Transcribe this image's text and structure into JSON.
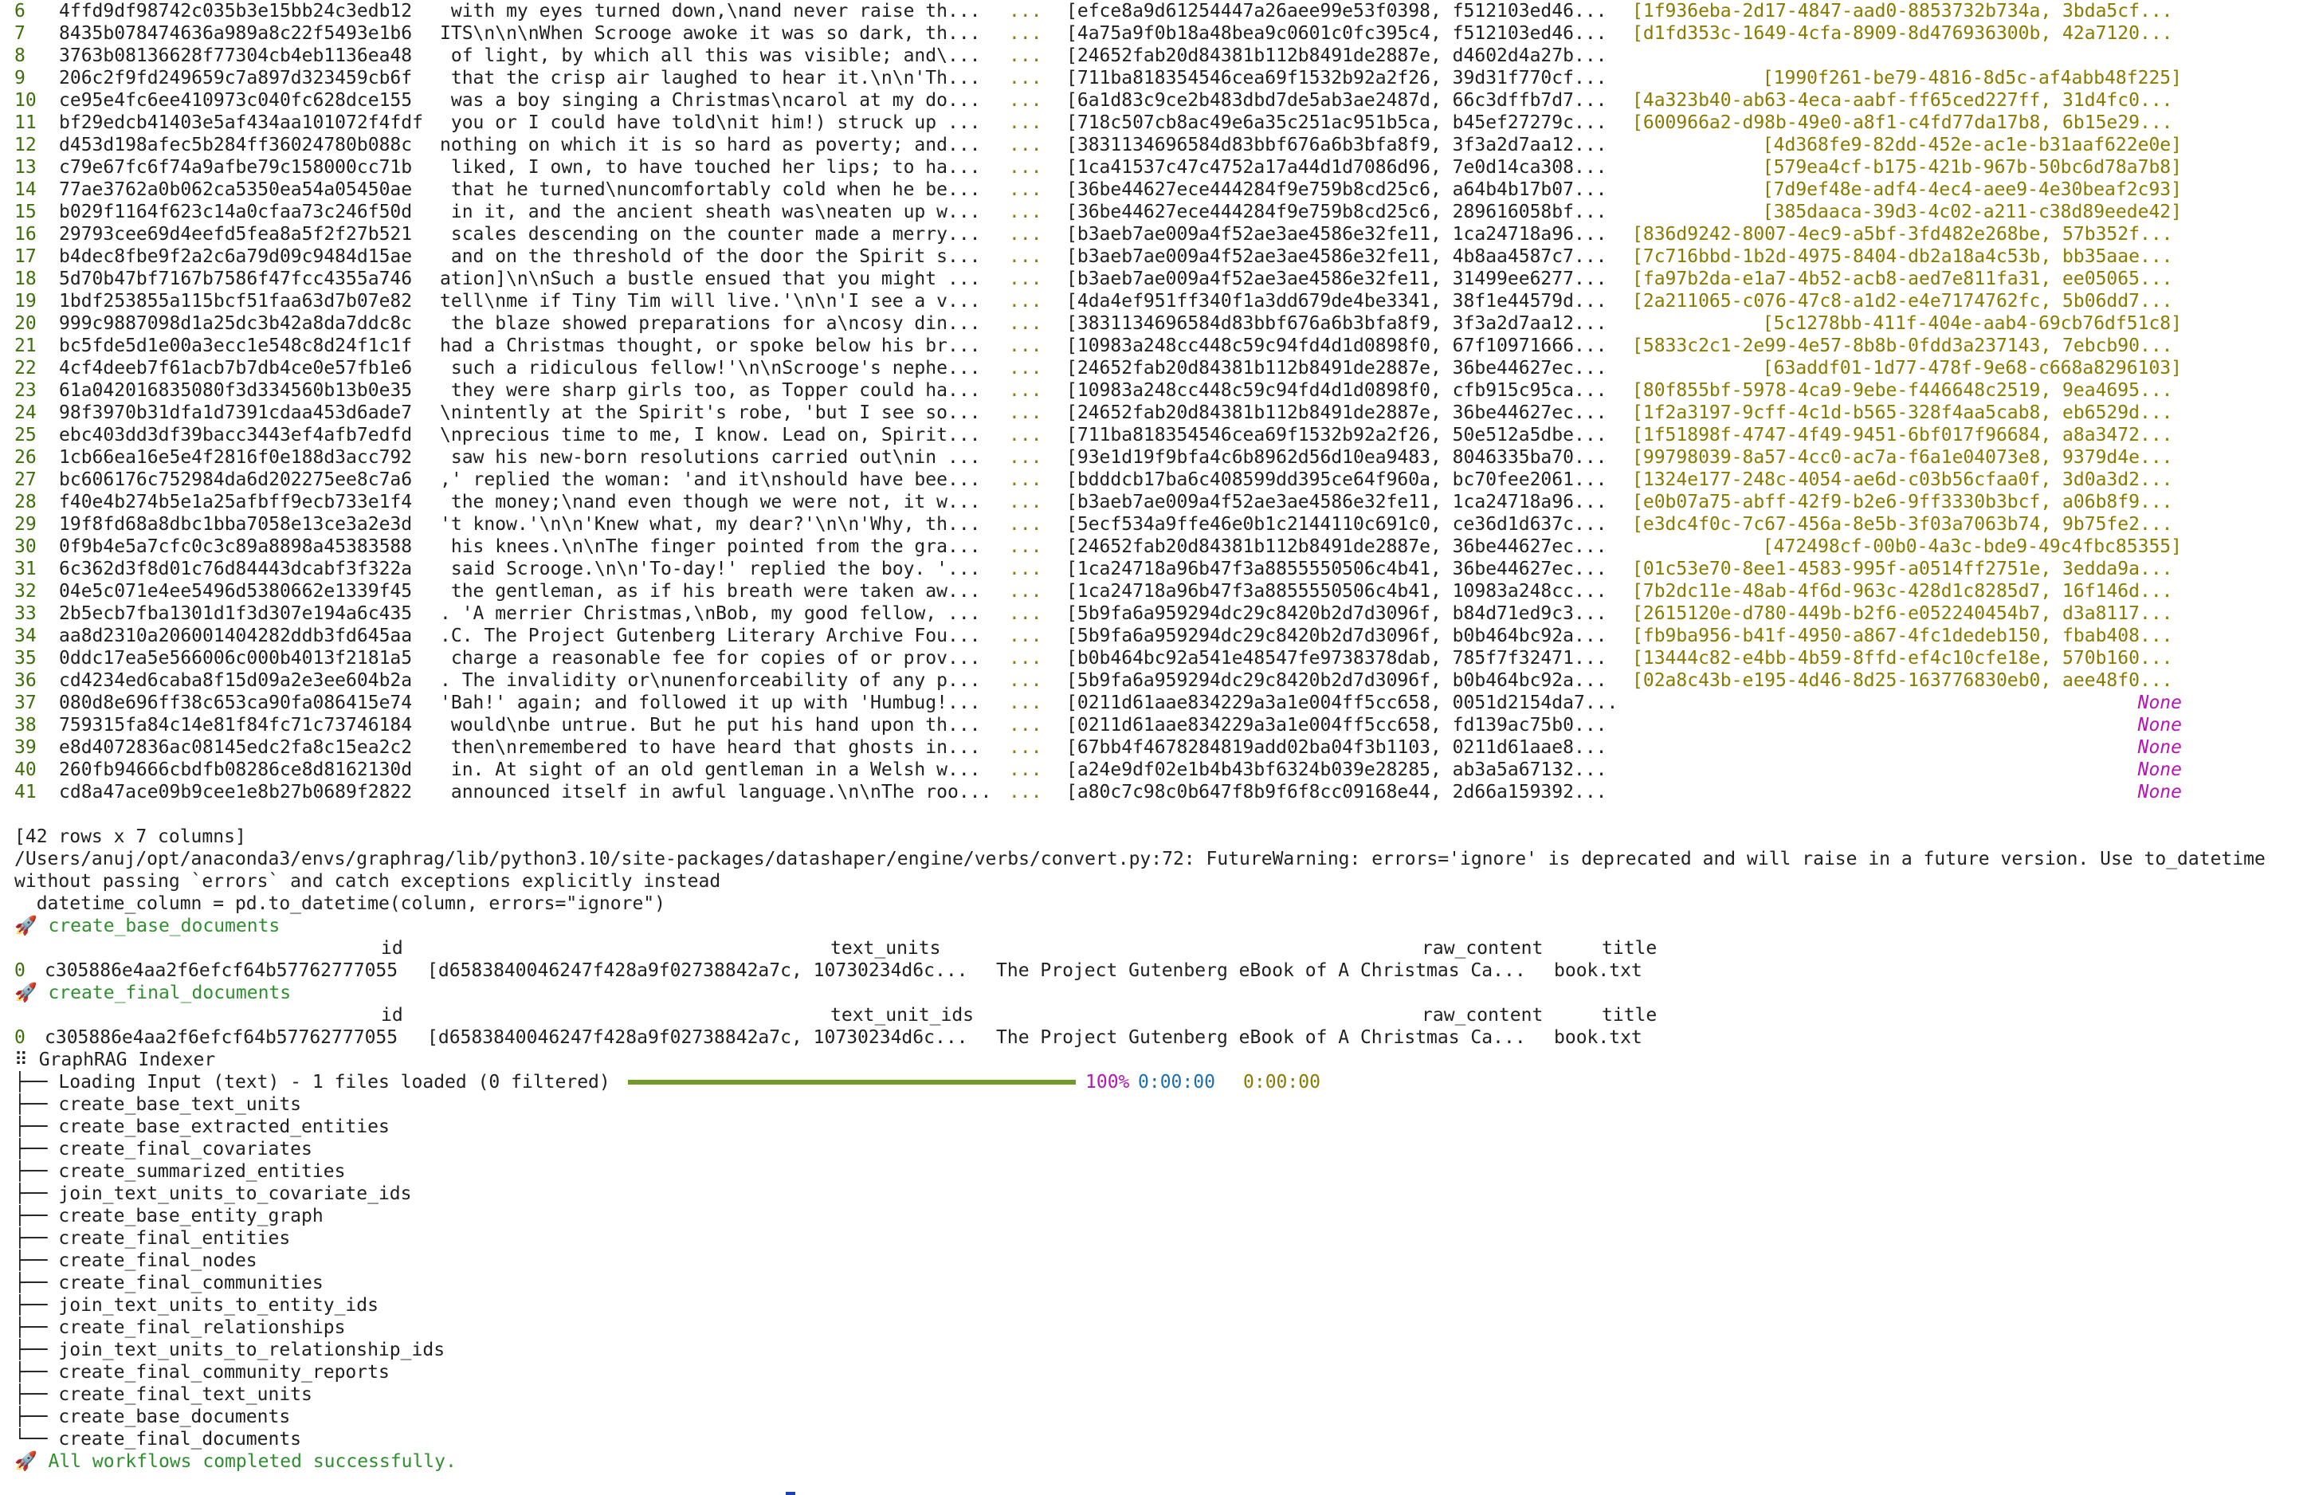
{
  "colors": {
    "index": "#3d6f0a",
    "olive": "#8a7a00",
    "string": "#2f8f2f",
    "none": "#b516b5",
    "progress": "#6f9a2a",
    "time": "#1a6fb0"
  },
  "table_rows": [
    {
      "idx": "6",
      "id": "4ffd9df98742c035b3e15bb24c3edb12",
      "text": " with my eyes turned down,\\nand never raise th...",
      "ell": "...",
      "doc": "[efce8a9d61254447a26aee99e53f0398, f512103ed46...",
      "rel": "[1f936eba-2d17-4847-aad0-8853732b734a, 3bda5cf...",
      "rel_right": false
    },
    {
      "idx": "7",
      "id": "8435b078474636a989a8c22f5493e1b6",
      "text": "ITS\\n\\n\\nWhen Scrooge awoke it was so dark, th...",
      "ell": "...",
      "doc": "[4a75a9f0b18a48bea9c0601c0fc395c4, f512103ed46...",
      "rel": "[d1fd353c-1649-4cfa-8909-8d476936300b, 42a7120...",
      "rel_right": false
    },
    {
      "idx": "8",
      "id": "3763b08136628f77304cb4eb1136ea48",
      "text": " of light, by which all this was visible; and\\...",
      "ell": "...",
      "doc": "[24652fab20d84381b112b8491de2887e, d4602d4a27b...",
      "rel": "",
      "rel_right": false
    },
    {
      "idx": "9",
      "id": "206c2f9fd249659c7a897d323459cb6f",
      "text": " that the crisp air laughed to hear it.\\n\\n'Th...",
      "ell": "...",
      "doc": "[711ba818354546cea69f1532b92a2f26, 39d31f770cf...",
      "rel": "[1990f261-be79-4816-8d5c-af4abb48f225]",
      "rel_right": true
    },
    {
      "idx": "10",
      "id": "ce95e4fc6ee410973c040fc628dce155",
      "text": " was a boy singing a Christmas\\ncarol at my do...",
      "ell": "...",
      "doc": "[6a1d83c9ce2b483dbd7de5ab3ae2487d, 66c3dffb7d7...",
      "rel": "[4a323b40-ab63-4eca-aabf-ff65ced227ff, 31d4fc0...",
      "rel_right": false
    },
    {
      "idx": "11",
      "id": "bf29edcb41403e5af434aa101072f4fdf",
      "text": " you or I could have told\\nit him!) struck up ...",
      "ell": "...",
      "doc": "[718c507cb8ac49e6a35c251ac951b5ca, b45ef27279c...",
      "rel": "[600966a2-d98b-49e0-a8f1-c4fd77da17b8, 6b15e29...",
      "rel_right": false
    },
    {
      "idx": "12",
      "id": "d453d198afec5b284ff36024780b088c",
      "text": "nothing on which it is so hard as poverty; and...",
      "ell": "...",
      "doc": "[3831134696584d83bbf676a6b3bfa8f9, 3f3a2d7aa12...",
      "rel": "[4d368fe9-82dd-452e-ac1e-b31aaf622e0e]",
      "rel_right": true
    },
    {
      "idx": "13",
      "id": "c79e67fc6f74a9afbe79c158000cc71b",
      "text": " liked, I own, to have touched her lips; to ha...",
      "ell": "...",
      "doc": "[1ca41537c47c4752a17a44d1d7086d96, 7e0d14ca308...",
      "rel": "[579ea4cf-b175-421b-967b-50bc6d78a7b8]",
      "rel_right": true
    },
    {
      "idx": "14",
      "id": "77ae3762a0b062ca5350ea54a05450ae",
      "text": " that he turned\\nuncomfortably cold when he be...",
      "ell": "...",
      "doc": "[36be44627ece444284f9e759b8cd25c6, a64b4b17b07...",
      "rel": "[7d9ef48e-adf4-4ec4-aee9-4e30beaf2c93]",
      "rel_right": true
    },
    {
      "idx": "15",
      "id": "b029f1164f623c14a0cfaa73c246f50d",
      "text": " in it, and the ancient sheath was\\neaten up w...",
      "ell": "...",
      "doc": "[36be44627ece444284f9e759b8cd25c6, 289616058bf...",
      "rel": "[385daaca-39d3-4c02-a211-c38d89eede42]",
      "rel_right": true
    },
    {
      "idx": "16",
      "id": "29793cee69d4eefd5fea8a5f2f27b521",
      "text": " scales descending on the counter made a merry...",
      "ell": "...",
      "doc": "[b3aeb7ae009a4f52ae3ae4586e32fe11, 1ca24718a96...",
      "rel": "[836d9242-8007-4ec9-a5bf-3fd482e268be, 57b352f...",
      "rel_right": false
    },
    {
      "idx": "17",
      "id": "b4dec8fbe9f2a2c6a79d09c9484d15ae",
      "text": " and on the threshold of the door the Spirit s...",
      "ell": "...",
      "doc": "[b3aeb7ae009a4f52ae3ae4586e32fe11, 4b8aa4587c7...",
      "rel": "[7c716bbd-1b2d-4975-8404-db2a18a4c53b, bb35aae...",
      "rel_right": false
    },
    {
      "idx": "18",
      "id": "5d70b47bf7167b7586f47fcc4355a746",
      "text": "ation]\\n\\nSuch a bustle ensued that you might ...",
      "ell": "...",
      "doc": "[b3aeb7ae009a4f52ae3ae4586e32fe11, 31499ee6277...",
      "rel": "[fa97b2da-e1a7-4b52-acb8-aed7e811fa31, ee05065...",
      "rel_right": false
    },
    {
      "idx": "19",
      "id": "1bdf253855a115bcf51faa63d7b07e82",
      "text": "tell\\nme if Tiny Tim will live.'\\n\\n'I see a v...",
      "ell": "...",
      "doc": "[4da4ef951ff340f1a3dd679de4be3341, 38f1e44579d...",
      "rel": "[2a211065-c076-47c8-a1d2-e4e7174762fc, 5b06dd7...",
      "rel_right": false
    },
    {
      "idx": "20",
      "id": "999c9887098d1a25dc3b42a8da7ddc8c",
      "text": " the blaze showed preparations for a\\ncosy din...",
      "ell": "...",
      "doc": "[3831134696584d83bbf676a6b3bfa8f9, 3f3a2d7aa12...",
      "rel": "[5c1278bb-411f-404e-aab4-69cb76df51c8]",
      "rel_right": true
    },
    {
      "idx": "21",
      "id": "bc5fde5d1e00a3ecc1e548c8d24f1c1f",
      "text": "had a Christmas thought, or spoke below his br...",
      "ell": "...",
      "doc": "[10983a248cc448c59c94fd4d1d0898f0, 67f10971666...",
      "rel": "[5833c2c1-2e99-4e57-8b8b-0fdd3a237143, 7ebcb90...",
      "rel_right": false
    },
    {
      "idx": "22",
      "id": "4cf4deeb7f61acb7b7db4ce0e57fb1e6",
      "text": " such a ridiculous fellow!'\\n\\nScrooge's nephe...",
      "ell": "...",
      "doc": "[24652fab20d84381b112b8491de2887e, 36be44627ec...",
      "rel": "[63addf01-1d77-478f-9e68-c668a8296103]",
      "rel_right": true
    },
    {
      "idx": "23",
      "id": "61a042016835080f3d334560b13b0e35",
      "text": " they were sharp girls too, as Topper could ha...",
      "ell": "...",
      "doc": "[10983a248cc448c59c94fd4d1d0898f0, cfb915c95ca...",
      "rel": "[80f855bf-5978-4ca9-9ebe-f446648c2519, 9ea4695...",
      "rel_right": false
    },
    {
      "idx": "24",
      "id": "98f3970b31dfa1d7391cdaa453d6ade7",
      "text": "\\nintently at the Spirit's robe, 'but I see so...",
      "ell": "...",
      "doc": "[24652fab20d84381b112b8491de2887e, 36be44627ec...",
      "rel": "[1f2a3197-9cff-4c1d-b565-328f4aa5cab8, eb6529d...",
      "rel_right": false
    },
    {
      "idx": "25",
      "id": "ebc403dd3df39bacc3443ef4afb7edfd",
      "text": "\\nprecious time to me, I know. Lead on, Spirit...",
      "ell": "...",
      "doc": "[711ba818354546cea69f1532b92a2f26, 50e512a5dbe...",
      "rel": "[1f51898f-4747-4f49-9451-6bf017f96684, a8a3472...",
      "rel_right": false
    },
    {
      "idx": "26",
      "id": "1cb66ea16e5e4f2816f0e188d3acc792",
      "text": " saw his new-born resolutions carried out\\nin ...",
      "ell": "...",
      "doc": "[93e1d19f9bfa4c6b8962d56d10ea9483, 8046335ba70...",
      "rel": "[99798039-8a57-4cc0-ac7a-f6a1e04073e8, 9379d4e...",
      "rel_right": false
    },
    {
      "idx": "27",
      "id": "bc606176c752984da6d202275ee8c7a6",
      "text": ",' replied the woman: 'and it\\nshould have bee...",
      "ell": "...",
      "doc": "[bdddcb17ba6c408599dd395ce64f960a, bc70fee2061...",
      "rel": "[1324e177-248c-4054-ae6d-c03b56cfaa0f, 3d0a3d2...",
      "rel_right": false
    },
    {
      "idx": "28",
      "id": "f40e4b274b5e1a25afbff9ecb733e1f4",
      "text": " the money;\\nand even though we were not, it w...",
      "ell": "...",
      "doc": "[b3aeb7ae009a4f52ae3ae4586e32fe11, 1ca24718a96...",
      "rel": "[e0b07a75-abff-42f9-b2e6-9ff3330b3bcf, a06b8f9...",
      "rel_right": false
    },
    {
      "idx": "29",
      "id": "19f8fd68a8dbc1bba7058e13ce3a2e3d",
      "text": "'t know.'\\n\\n'Knew what, my dear?'\\n\\n'Why, th...",
      "ell": "...",
      "doc": "[5ecf534a9ffe46e0b1c2144110c691c0, ce36d1d637c...",
      "rel": "[e3dc4f0c-7c67-456a-8e5b-3f03a7063b74, 9b75fe2...",
      "rel_right": false
    },
    {
      "idx": "30",
      "id": "0f9b4e5a7cfc0c3c89a8898a45383588",
      "text": " his knees.\\n\\nThe finger pointed from the gra...",
      "ell": "...",
      "doc": "[24652fab20d84381b112b8491de2887e, 36be44627ec...",
      "rel": "[472498cf-00b0-4a3c-bde9-49c4fbc85355]",
      "rel_right": true
    },
    {
      "idx": "31",
      "id": "6c362d3f8d01c76d84443dcabf3f322a",
      "text": " said Scrooge.\\n\\n'To-day!' replied the boy. '...",
      "ell": "...",
      "doc": "[1ca24718a96b47f3a8855550506c4b41, 36be44627ec...",
      "rel": "[01c53e70-8ee1-4583-995f-a0514ff2751e, 3edda9a...",
      "rel_right": false
    },
    {
      "idx": "32",
      "id": "04e5c071e4ee5496d5380662e1339f45",
      "text": " the gentleman, as if his breath were taken aw...",
      "ell": "...",
      "doc": "[1ca24718a96b47f3a8855550506c4b41, 10983a248cc...",
      "rel": "[7b2dc11e-48ab-4f6d-963c-428d1c8285d7, 16f146d...",
      "rel_right": false
    },
    {
      "idx": "33",
      "id": "2b5ecb7fba1301d1f3d307e194a6c435",
      "text": ". 'A merrier Christmas,\\nBob, my good fellow, ...",
      "ell": "...",
      "doc": "[5b9fa6a959294dc29c8420b2d7d3096f, b84d71ed9c3...",
      "rel": "[2615120e-d780-449b-b2f6-e052240454b7, d3a8117...",
      "rel_right": false
    },
    {
      "idx": "34",
      "id": "aa8d2310a206001404282ddb3fd645aa",
      "text": ".C. The Project Gutenberg Literary Archive Fou...",
      "ell": "...",
      "doc": "[5b9fa6a959294dc29c8420b2d7d3096f, b0b464bc92a...",
      "rel": "[fb9ba956-b41f-4950-a867-4fc1dedeb150, fbab408...",
      "rel_right": false
    },
    {
      "idx": "35",
      "id": "0ddc17ea5e566006c000b4013f2181a5",
      "text": " charge a reasonable fee for copies of or prov...",
      "ell": "...",
      "doc": "[b0b464bc92a541e48547fe9738378dab, 785f7f32471...",
      "rel": "[13444c82-e4bb-4b59-8ffd-ef4c10cfe18e, 570b160...",
      "rel_right": false
    },
    {
      "idx": "36",
      "id": "cd4234ed6caba8f15d09a2e3ee604b2a",
      "text": ". The invalidity or\\nunenforceability of any p...",
      "ell": "...",
      "doc": "[5b9fa6a959294dc29c8420b2d7d3096f, b0b464bc92a...",
      "rel": "[02a8c43b-e195-4d46-8d25-163776830eb0, aee48f0...",
      "rel_right": false
    },
    {
      "idx": "37",
      "id": "080d8e696ff38c653ca90fa086415e74",
      "text": "'Bah!' again; and followed it up with 'Humbug!...",
      "ell": "...",
      "doc": "[0211d61aae834229a3a1e004ff5cc658, 0051d2154da7...",
      "rel": "None",
      "rel_right": true
    },
    {
      "idx": "38",
      "id": "759315fa84c14e81f84fc71c73746184",
      "text": " would\\nbe untrue. But he put his hand upon th...",
      "ell": "...",
      "doc": "[0211d61aae834229a3a1e004ff5cc658, fd139ac75b0...",
      "rel": "None",
      "rel_right": true
    },
    {
      "idx": "39",
      "id": "e8d4072836ac08145edc2fa8c15ea2c2",
      "text": " then\\nremembered to have heard that ghosts in...",
      "ell": "...",
      "doc": "[67bb4f4678284819add02ba04f3b1103, 0211d61aae8...",
      "rel": "None",
      "rel_right": true
    },
    {
      "idx": "40",
      "id": "260fb94666cbdfb08286ce8d8162130d",
      "text": " in. At sight of an old gentleman in a Welsh w...",
      "ell": "...",
      "doc": "[a24e9df02e1b4b43bf6324b039e28285, ab3a5a67132...",
      "rel": "None",
      "rel_right": true
    },
    {
      "idx": "41",
      "id": "cd8a47ace09b9cee1e8b27b0689f2822",
      "text": " announced itself in awful language.\\n\\nThe roo...",
      "ell": "...",
      "doc": "[a80c7c98c0b647f8b9f6f8cc09168e44, 2d66a159392...",
      "rel": "None",
      "rel_right": true
    }
  ],
  "summary": "[42 rows x 7 columns]",
  "warning_line1": "/Users/anuj/opt/anaconda3/envs/graphrag/lib/python3.10/site-packages/datashaper/engine/verbs/convert.py:72: FutureWarning: errors='ignore' is deprecated and will raise in a future version. Use to_datetime",
  "warning_line2": "without passing `errors` and catch exceptions explicitly instead",
  "warning_line3": "  datetime_column = pd.to_datetime(column, errors=\"ignore\")",
  "base_docs": {
    "heading": "🚀 create_base_documents",
    "cols": {
      "id": "id",
      "units": "text_units",
      "raw": "raw_content",
      "title": "title"
    },
    "row": {
      "idx": "0",
      "id": "c305886e4aa2f6efcf64b57762777055",
      "units": "[d6583840046247f428a9f02738842a7c, 10730234d6c...",
      "raw": "The Project Gutenberg eBook of A Christmas Ca...",
      "title": "book.txt"
    }
  },
  "final_docs": {
    "heading": "🚀 create_final_documents",
    "cols": {
      "id": "id",
      "units": "text_unit_ids",
      "raw": "raw_content",
      "title": "title"
    },
    "row": {
      "idx": "0",
      "id": "c305886e4aa2f6efcf64b57762777055",
      "units": "[d6583840046247f428a9f02738842a7c, 10730234d6c...",
      "raw": "The Project Gutenberg eBook of A Christmas Ca...",
      "title": "book.txt"
    }
  },
  "indexer": {
    "title": "⠿ GraphRAG Indexer",
    "loading": "├── Loading Input (text) - 1 files loaded (0 filtered)",
    "progress": 1.0,
    "percent": "100%",
    "elapsed": "0:00:00",
    "remaining": "0:00:00",
    "steps": [
      "├── create_base_text_units",
      "├── create_base_extracted_entities",
      "├── create_final_covariates",
      "├── create_summarized_entities",
      "├── join_text_units_to_covariate_ids",
      "├── create_base_entity_graph",
      "├── create_final_entities",
      "├── create_final_nodes",
      "├── create_final_communities",
      "├── join_text_units_to_entity_ids",
      "├── create_final_relationships",
      "├── join_text_units_to_relationship_ids",
      "├── create_final_community_reports",
      "├── create_final_text_units",
      "├── create_base_documents",
      "└── create_final_documents"
    ]
  },
  "done": "🚀 All workflows completed successfully."
}
